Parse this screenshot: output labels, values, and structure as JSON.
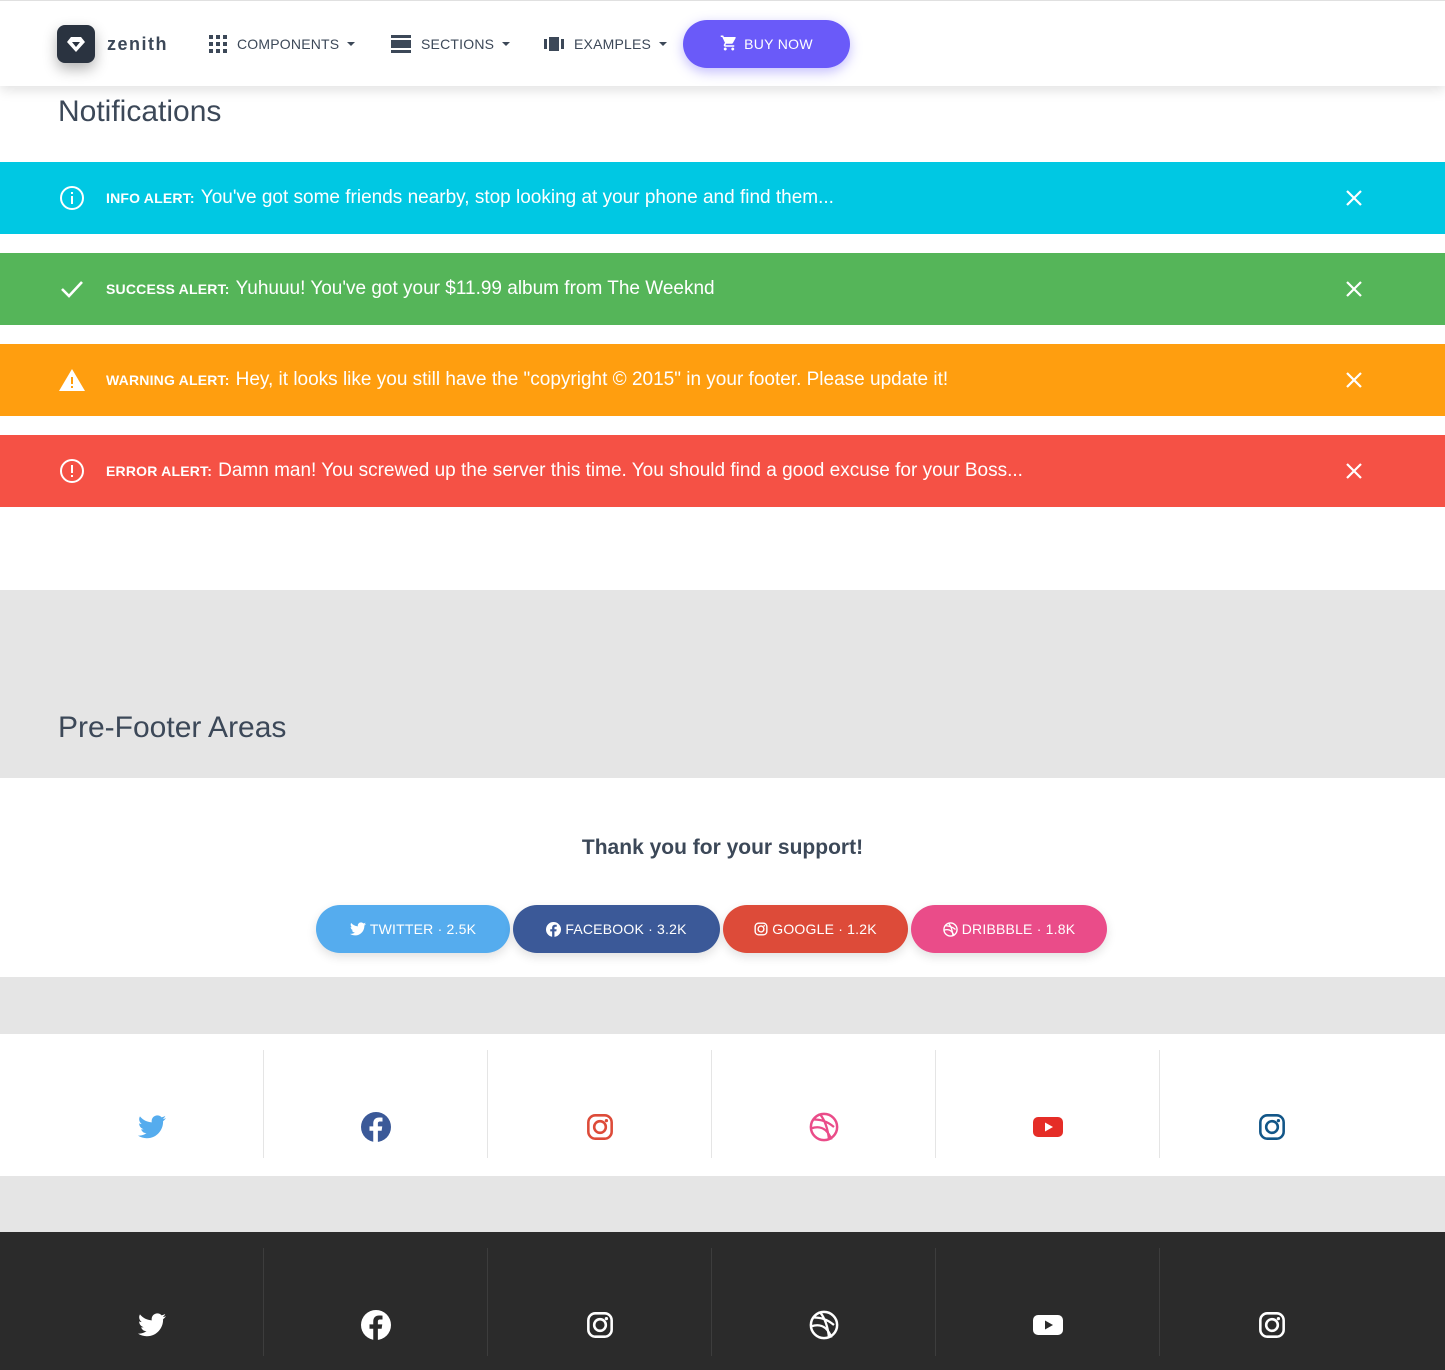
{
  "navbar": {
    "brand": "zenith",
    "items": [
      {
        "label": "COMPONENTS",
        "icon": "grid-icon"
      },
      {
        "label": "SECTIONS",
        "icon": "sections-icon"
      },
      {
        "label": "EXAMPLES",
        "icon": "carousel-icon"
      }
    ],
    "buy_label": "BUY NOW"
  },
  "notifications": {
    "title": "Notifications",
    "alerts": [
      {
        "type": "info",
        "label": "INFO ALERT:",
        "text": "You've got some friends nearby, stop looking at your phone and find them...",
        "color": "#00c8e3"
      },
      {
        "type": "success",
        "label": "SUCCESS ALERT:",
        "text": "Yuhuuu! You've got your $11.99 album from The Weeknd",
        "color": "#55b559"
      },
      {
        "type": "warning",
        "label": "WARNING ALERT:",
        "text": "Hey, it looks like you still have the \"copyright © 2015\" in your footer. Please update it!",
        "color": "#ff9e0f"
      },
      {
        "type": "danger",
        "label": "ERROR ALERT:",
        "text": "Damn man! You screwed up the server this time. You should find a good excuse for your Boss...",
        "color": "#f55145"
      }
    ]
  },
  "prefooter": {
    "title": "Pre-Footer Areas",
    "support_title": "Thank you for your support!",
    "buttons": [
      {
        "label": "TWITTER · 2.5K",
        "color": "#55acee",
        "icon": "twitter-icon"
      },
      {
        "label": "FACEBOOK · 3.2K",
        "color": "#3b5998",
        "icon": "facebook-icon"
      },
      {
        "label": "GOOGLE · 1.2K",
        "color": "#dd4b39",
        "icon": "instagram-icon"
      },
      {
        "label": "DRIBBBLE · 1.8K",
        "color": "#ea4c89",
        "icon": "dribbble-icon"
      }
    ],
    "icon_row_icons": [
      "twitter-icon",
      "facebook-icon",
      "instagram-icon",
      "dribbble-icon",
      "youtube-icon",
      "instagram-icon"
    ],
    "icon_colors": [
      "#55acee",
      "#3b5998",
      "#dd4b39",
      "#ea4c89",
      "#e52d27",
      "#125688"
    ]
  }
}
